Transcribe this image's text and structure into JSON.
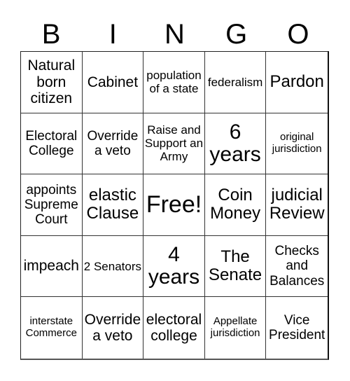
{
  "header": {
    "letters": [
      "B",
      "I",
      "N",
      "G",
      "O"
    ]
  },
  "card": {
    "rows": [
      [
        "Natural born citizen",
        "Cabinet",
        "population of a state",
        "federalism",
        "Pardon"
      ],
      [
        "Electoral College",
        "Override a veto",
        "Raise and Support an Army",
        "6 years",
        "original jurisdiction"
      ],
      [
        "appoints Supreme Court",
        "elastic Clause",
        "Free!",
        "Coin Money",
        "judicial Review"
      ],
      [
        "impeach",
        "2 Senators",
        "4 years",
        "The Senate",
        "Checks and Balances"
      ],
      [
        "interstate Commerce",
        "Override a veto",
        "electoral college",
        "Appellate jurisdiction",
        "Vice President"
      ]
    ],
    "free_space": "Free!"
  },
  "colors": {
    "background": "#ffffff",
    "text": "#000000",
    "grid_line": "#333333"
  }
}
